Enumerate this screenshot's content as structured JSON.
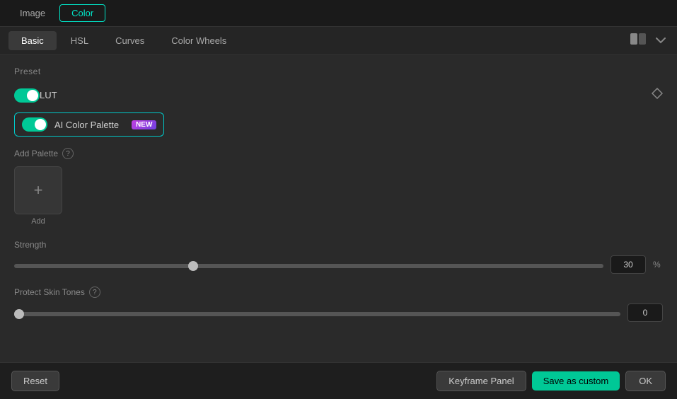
{
  "topbar": {
    "image_label": "Image",
    "color_label": "Color"
  },
  "tabs": {
    "items": [
      {
        "label": "Basic",
        "active": true
      },
      {
        "label": "HSL",
        "active": false
      },
      {
        "label": "Curves",
        "active": false
      },
      {
        "label": "Color Wheels",
        "active": false
      }
    ]
  },
  "preset": {
    "label": "Preset",
    "lut": {
      "label": "LUT",
      "enabled": true
    },
    "ai_color_palette": {
      "label": "AI Color Palette",
      "badge": "NEW",
      "enabled": false
    }
  },
  "add_palette": {
    "label": "Add Palette",
    "info_tooltip": "?",
    "add_box_label": "Add"
  },
  "strength": {
    "label": "Strength",
    "value": "30",
    "unit": "%",
    "percent": 30
  },
  "protect_skin_tones": {
    "label": "Protect Skin Tones",
    "info_tooltip": "?",
    "value": "0",
    "percent": 0
  },
  "bottom": {
    "reset_label": "Reset",
    "keyframe_label": "Keyframe Panel",
    "save_custom_label": "Save as custom",
    "ok_label": "OK"
  },
  "icons": {
    "split_view": "⬜",
    "chevron_down": "⌄",
    "diamond": "◇"
  }
}
